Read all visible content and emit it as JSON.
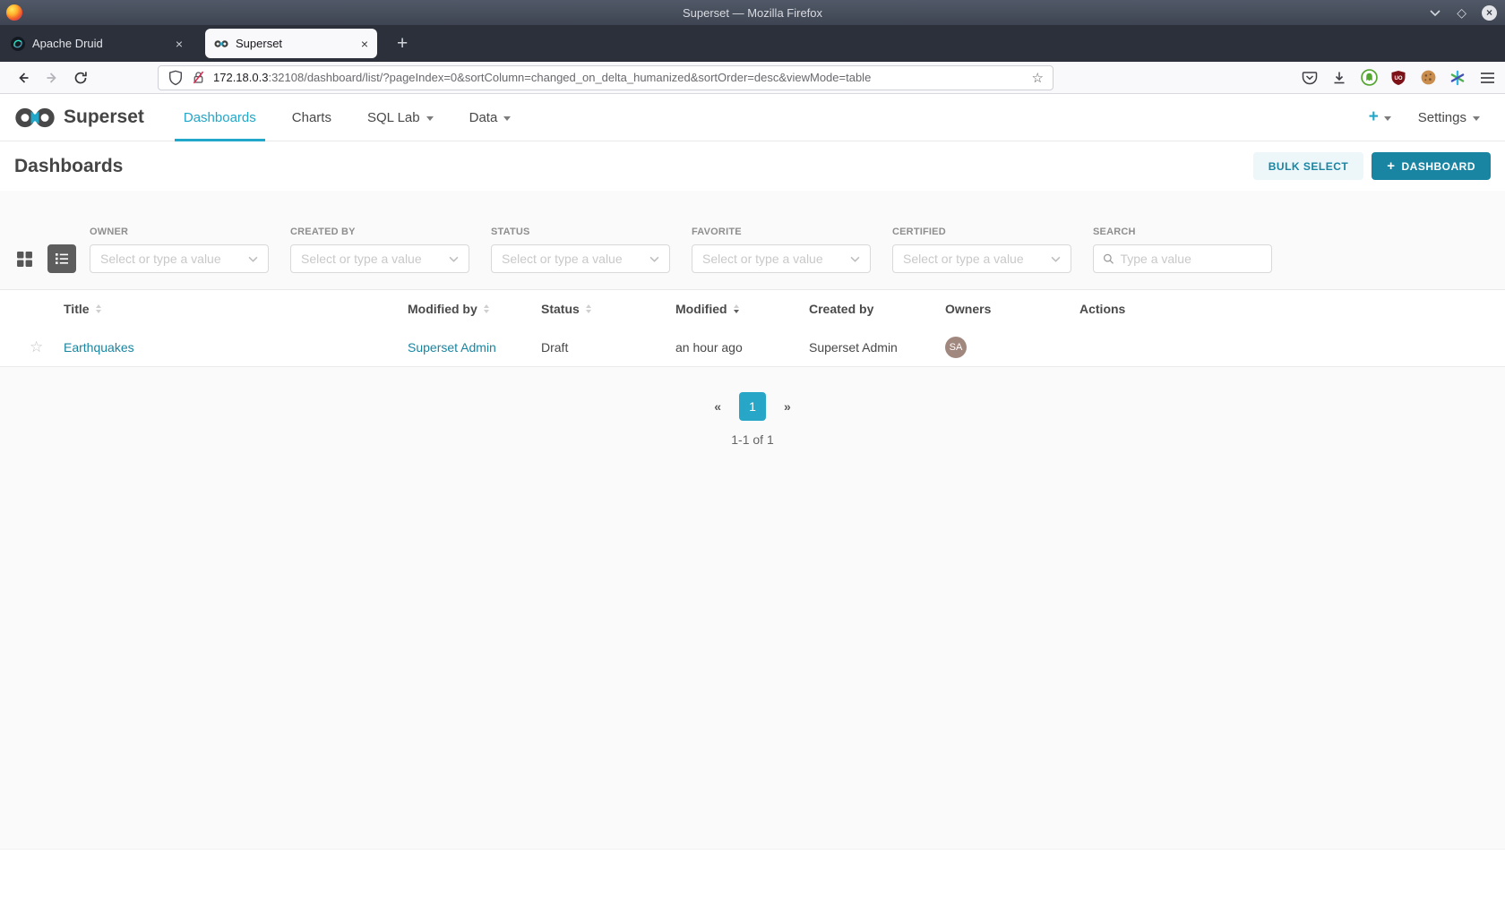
{
  "window": {
    "title": "Superset — Mozilla Firefox"
  },
  "browser": {
    "tabs": [
      {
        "label": "Apache Druid",
        "close": "×",
        "active": false
      },
      {
        "label": "Superset",
        "close": "×",
        "active": true
      }
    ],
    "new_tab": "+",
    "url": {
      "host": "172.18.0.3",
      "rest": ":32108/dashboard/list/?pageIndex=0&sortColumn=changed_on_delta_humanized&sortOrder=desc&viewMode=table"
    },
    "bookmark_star": "☆"
  },
  "navbar": {
    "brand": "Superset",
    "items": [
      {
        "label": "Dashboards",
        "active": true,
        "has_caret": false
      },
      {
        "label": "Charts",
        "active": false,
        "has_caret": false
      },
      {
        "label": "SQL Lab",
        "active": false,
        "has_caret": true
      },
      {
        "label": "Data",
        "active": false,
        "has_caret": true
      }
    ],
    "plus_label": "+",
    "settings_label": "Settings"
  },
  "page": {
    "title": "Dashboards",
    "bulk_select_label": "BULK SELECT",
    "new_button_plus": "+",
    "new_button_label": "DASHBOARD"
  },
  "filters": {
    "selects": [
      {
        "label": "OWNER",
        "placeholder": "Select or type a value"
      },
      {
        "label": "CREATED BY",
        "placeholder": "Select or type a value"
      },
      {
        "label": "STATUS",
        "placeholder": "Select or type a value"
      },
      {
        "label": "FAVORITE",
        "placeholder": "Select or type a value"
      },
      {
        "label": "CERTIFIED",
        "placeholder": "Select or type a value"
      }
    ],
    "search": {
      "label": "SEARCH",
      "placeholder": "Type a value"
    }
  },
  "table": {
    "columns": [
      "Title",
      "Modified by",
      "Status",
      "Modified",
      "Created by",
      "Owners",
      "Actions"
    ],
    "rows": [
      {
        "favorite": "☆",
        "title": "Earthquakes",
        "modified_by": "Superset Admin",
        "status": "Draft",
        "modified": "an hour ago",
        "created_by": "Superset Admin",
        "owner_initials": "SA"
      }
    ]
  },
  "pagination": {
    "prev": "«",
    "page": "1",
    "next": "»",
    "summary": "1-1 of 1"
  },
  "colors": {
    "accent": "#20a7c9",
    "primary_button": "#1a85a3",
    "link": "#1985a0",
    "avatar_bg": "#a1887f",
    "titlebar": "#464e5c",
    "tabbar": "#2b303b"
  }
}
